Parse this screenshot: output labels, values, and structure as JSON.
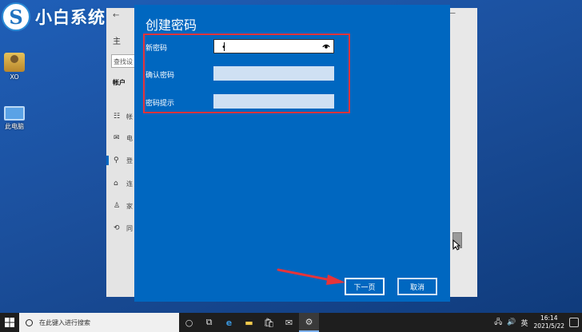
{
  "watermark": {
    "logo_letter": "S",
    "text": "小白系统"
  },
  "desktop": {
    "icons": [
      {
        "label": "XO",
        "icon": "user-folder-icon"
      },
      {
        "label": "此电脑",
        "icon": "computer-icon"
      }
    ]
  },
  "settings_window": {
    "back_glyph": "←",
    "home_label": "主",
    "search_placeholder": "查找设",
    "section_title": "帐户",
    "items": [
      {
        "glyph": "☷",
        "label": "帐"
      },
      {
        "glyph": "✉",
        "label": "电"
      },
      {
        "glyph": "⚲",
        "label": "登"
      },
      {
        "glyph": "⌂",
        "label": "连"
      },
      {
        "glyph": "♙",
        "label": "家"
      },
      {
        "glyph": "⟲",
        "label": "同"
      }
    ],
    "minimize_glyph": "—"
  },
  "dialog": {
    "title": "创建密码",
    "fields": [
      {
        "label": "新密码",
        "value": "•"
      },
      {
        "label": "确认密码",
        "value": ""
      },
      {
        "label": "密码提示",
        "value": ""
      }
    ],
    "next_label": "下一页",
    "cancel_label": "取消"
  },
  "taskbar": {
    "search_placeholder": "在此键入进行搜索",
    "input_method": "英",
    "time": "16:14",
    "date": "2021/5/22"
  },
  "colors": {
    "dialog_bg": "#0067c0",
    "highlight": "#e5343a",
    "taskbar_bg": "#1e1e1e"
  }
}
